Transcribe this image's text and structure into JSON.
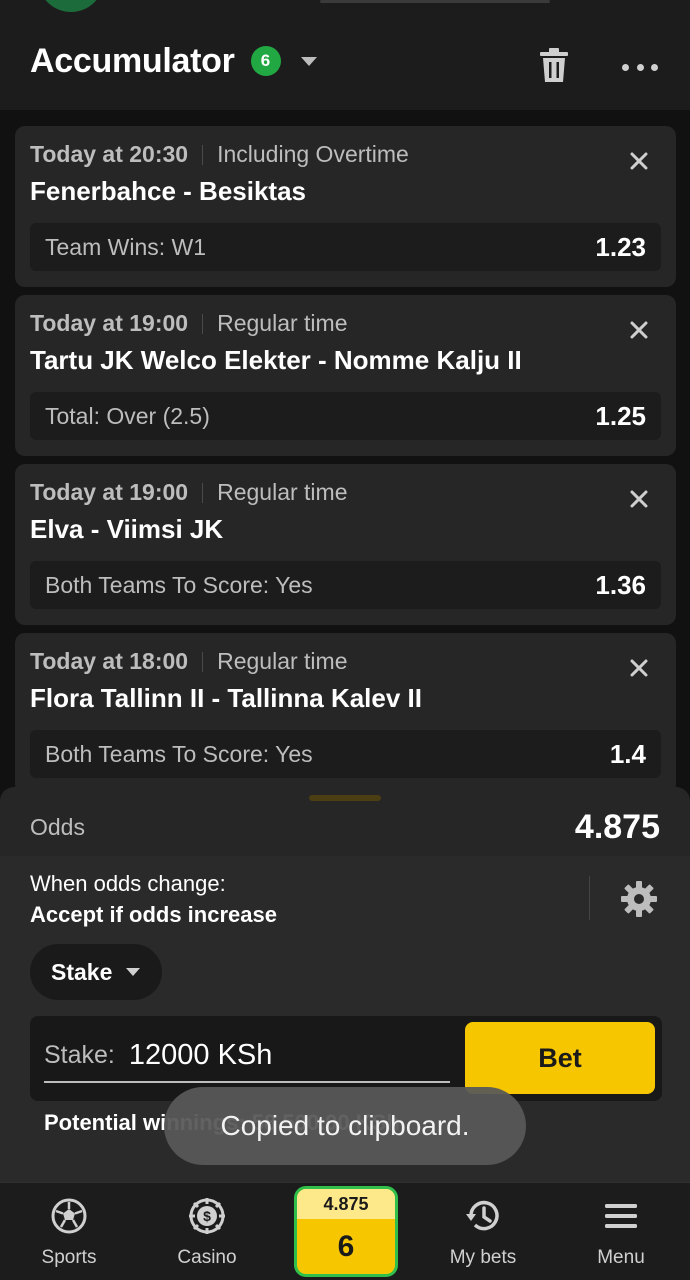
{
  "header": {
    "title": "Accumulator",
    "count": "6"
  },
  "bets": [
    {
      "time": "Today at 20:30",
      "period": "Including Overtime",
      "match": "Fenerbahce - Besiktas",
      "market": "Team Wins: W1",
      "odd": "1.23"
    },
    {
      "time": "Today at 19:00",
      "period": "Regular time",
      "match": "Tartu JK Welco Elekter - Nomme Kalju II",
      "market": "Total: Over (2.5)",
      "odd": "1.25"
    },
    {
      "time": "Today at 19:00",
      "period": "Regular time",
      "match": "Elva - Viimsi JK",
      "market": "Both Teams To Score: Yes",
      "odd": "1.36"
    },
    {
      "time": "Today at 18:00",
      "period": "Regular time",
      "match": "Flora Tallinn II - Tallinna Kalev II",
      "market": "Both Teams To Score: Yes",
      "odd": "1.4"
    }
  ],
  "summary": {
    "odds_label": "Odds",
    "odds_value": "4.875",
    "when_odds_change": "When odds change:",
    "accept_option": "Accept if odds increase",
    "stake_toggle": "Stake",
    "stake_prefix": "Stake:",
    "stake_amount": "12000 KSh",
    "bet_button": "Bet",
    "potential_winnings": "Potential winnings: 58 500.00 KSh"
  },
  "toast": "Copied to clipboard.",
  "nav": {
    "sports": "Sports",
    "casino": "Casino",
    "betslip_odds": "4.875",
    "betslip_count": "6",
    "my_bets": "My bets",
    "menu": "Menu"
  },
  "colors": {
    "accent_yellow": "#f6c700",
    "badge_green": "#22a843",
    "background": "#1c1c1c",
    "card": "#262626"
  }
}
